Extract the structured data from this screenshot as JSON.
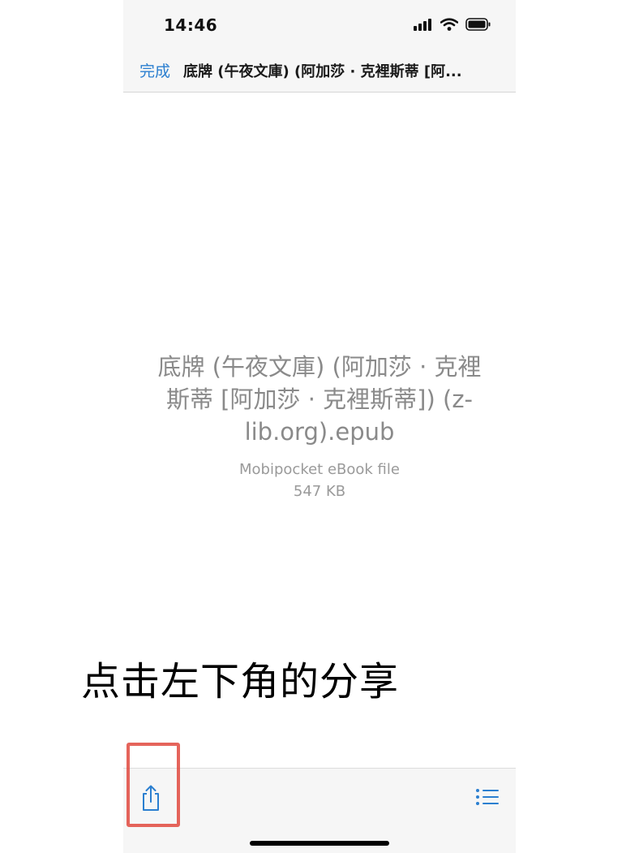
{
  "status_bar": {
    "time": "14:46",
    "icons": [
      "cellular-signal-icon",
      "wifi-icon",
      "battery-icon"
    ]
  },
  "nav": {
    "done_label": "完成",
    "title": "底牌 (午夜文庫) (阿加莎 · 克裡斯蒂 [阿..."
  },
  "file": {
    "name": "底牌 (午夜文庫) (阿加莎 · 克裡斯蒂 [阿加莎 · 克裡斯蒂]) (z-lib.org).epub",
    "type": "Mobipocket eBook file",
    "size": "547 KB"
  },
  "toolbar": {
    "left_icon": "share-icon",
    "right_icon": "list-icon"
  },
  "annotation": {
    "caption": "点击左下角的分享",
    "highlight_color": "#e0493e"
  },
  "colors": {
    "accent": "#2b7fd0",
    "bar_background": "#f6f6f6"
  }
}
